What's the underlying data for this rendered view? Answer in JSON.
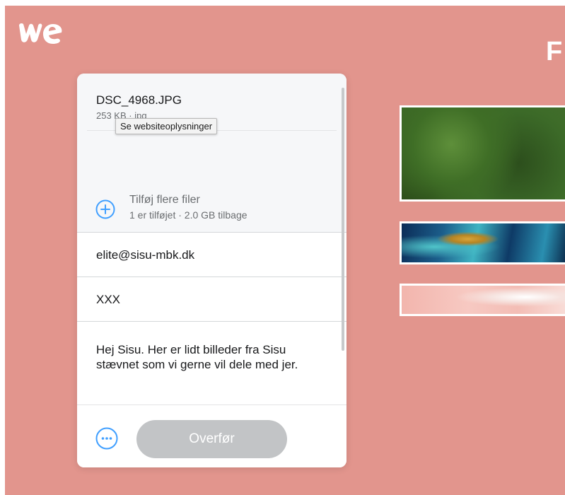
{
  "app": {
    "headline_fragment": "F"
  },
  "colors": {
    "background": "#e2958d",
    "accent": "#409fff",
    "button_disabled": "#c2c4c6"
  },
  "icons": {
    "logo": "wetransfer-logo",
    "add": "plus-circle-icon",
    "more": "more-options-icon"
  },
  "file": {
    "name": "DSC_4968.JPG",
    "meta": "253 KB · jpg"
  },
  "tooltip": {
    "text": "Se websiteoplysninger"
  },
  "add_files": {
    "title": "Tilføj flere filer",
    "subtitle": "1 er tilføjet · 2.0 GB tilbage"
  },
  "form": {
    "email": "elite@sisu-mbk.dk",
    "title": "XXX",
    "message": "Hej Sisu. Her er lidt billeder fra Sisu stævnet som vi gerne vil dele med jer."
  },
  "footer": {
    "transfer_label": "Overfør"
  }
}
